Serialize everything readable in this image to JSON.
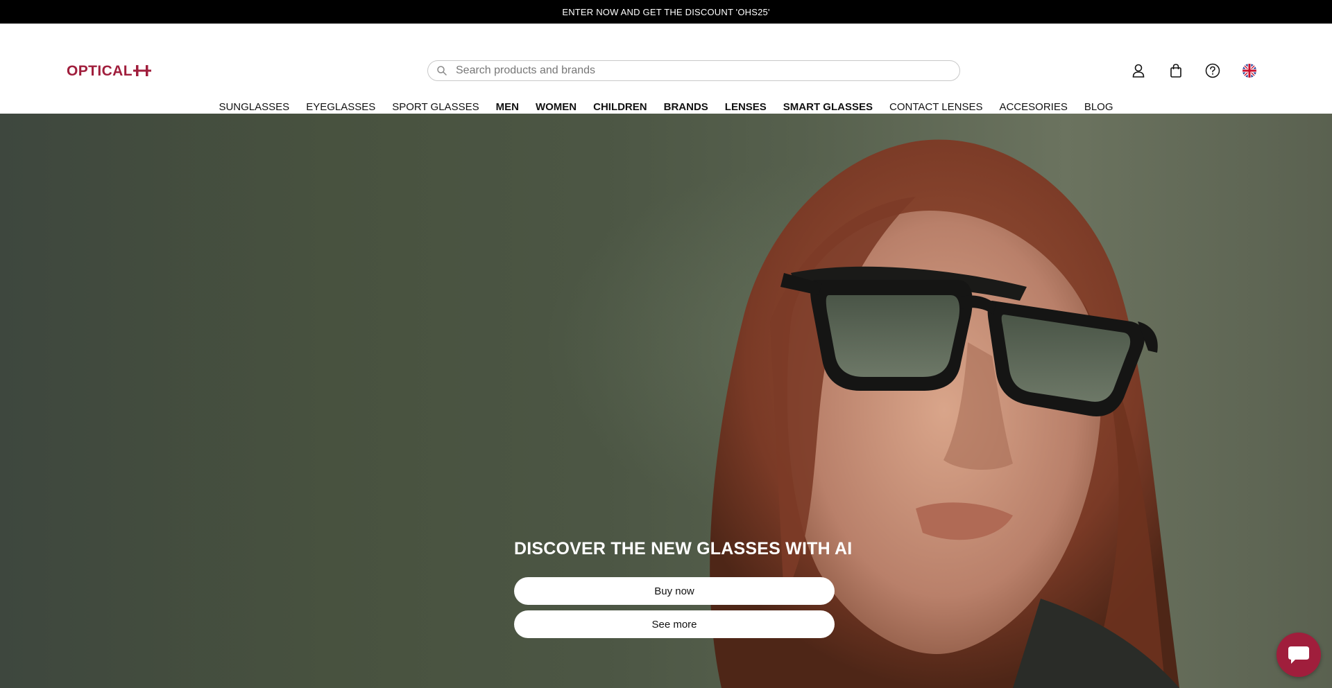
{
  "promo": {
    "text": "ENTER NOW AND GET THE DISCOUNT 'OHS25'"
  },
  "header": {
    "logo_text": "OPTICALH",
    "search": {
      "placeholder": "Search products and brands",
      "value": ""
    },
    "icons": [
      "user-icon",
      "shopping-bag-icon",
      "help-icon",
      "uk-flag-icon"
    ]
  },
  "nav": {
    "items": [
      {
        "label": "SUNGLASSES",
        "bold": false
      },
      {
        "label": "EYEGLASSES",
        "bold": false
      },
      {
        "label": "SPORT GLASSES",
        "bold": false
      },
      {
        "label": "MEN",
        "bold": true
      },
      {
        "label": "WOMEN",
        "bold": true
      },
      {
        "label": "CHILDREN",
        "bold": true
      },
      {
        "label": "BRANDS",
        "bold": true
      },
      {
        "label": "LENSES",
        "bold": true
      },
      {
        "label": "SMART GLASSES",
        "bold": true
      },
      {
        "label": "CONTACT LENSES",
        "bold": false
      },
      {
        "label": "ACCESORIES",
        "bold": false
      },
      {
        "label": "BLOG",
        "bold": false
      }
    ]
  },
  "hero": {
    "title": "DISCOVER THE NEW GLASSES WITH AI",
    "buy_label": "Buy now",
    "more_label": "See more"
  },
  "colors": {
    "brand": "#a01e3c",
    "promo_bg": "#000000"
  }
}
